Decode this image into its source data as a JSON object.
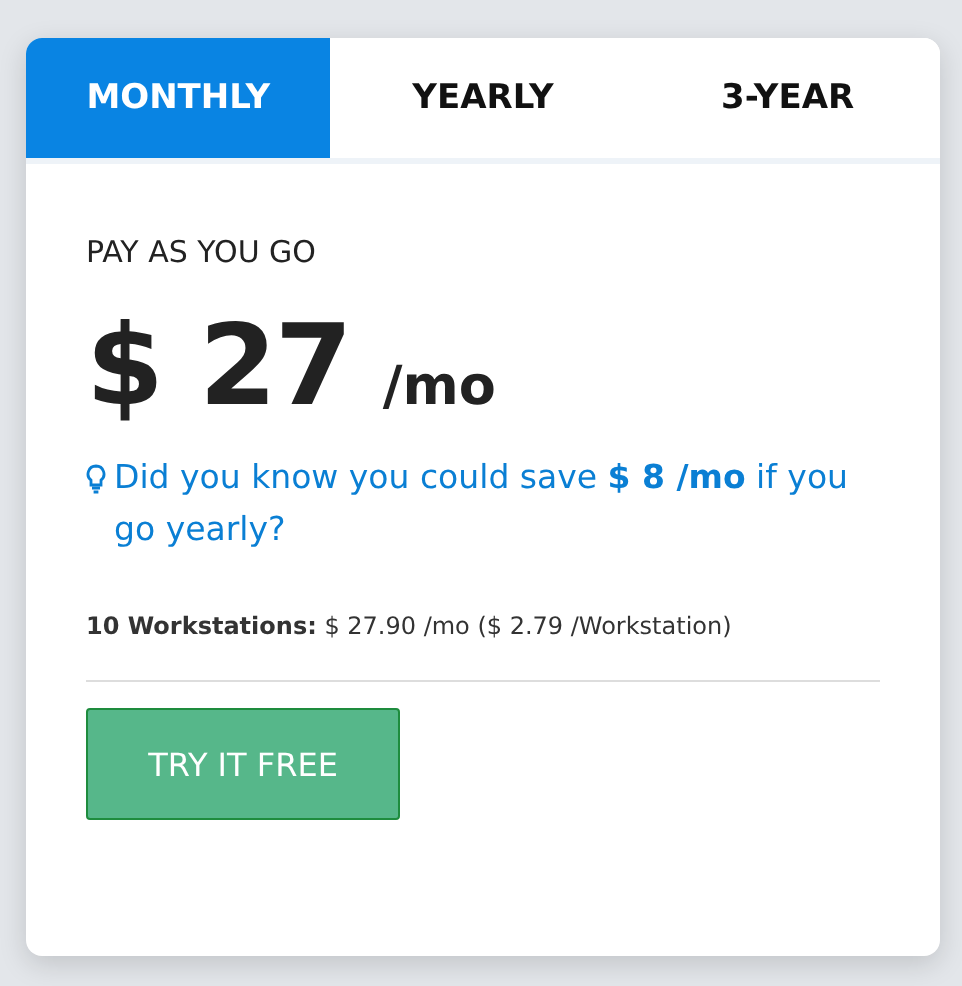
{
  "tabs": [
    {
      "label": "MONTHLY",
      "selected": true
    },
    {
      "label": "YEARLY",
      "selected": false
    },
    {
      "label": "3-YEAR",
      "selected": false
    }
  ],
  "plan": {
    "name": "PAY AS YOU GO",
    "price": "$ 27",
    "unit": "/mo"
  },
  "tip": "Did you know you could save **$ 8 /mo** if you go yearly?",
  "detail": "**10 Workstations:** $ 27.90 /mo ($ 2.79 /Workstation)",
  "button": "TRY IT FREE"
}
